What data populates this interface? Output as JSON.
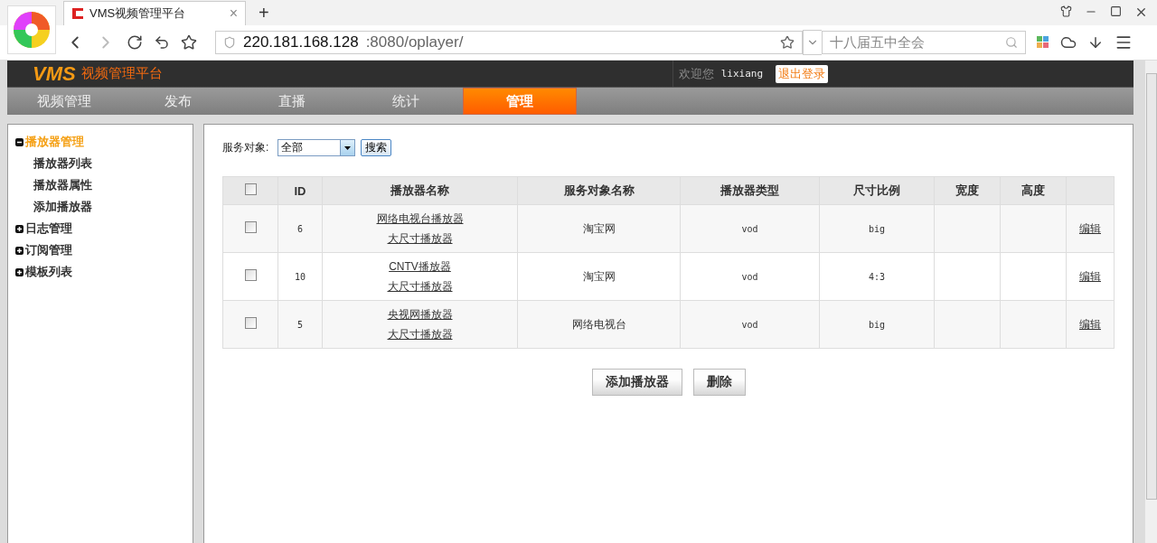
{
  "browser": {
    "tab_title": "VMS视频管理平台",
    "tab_close": "×",
    "new_tab": "+",
    "url_host": "220.181.168.128",
    "url_rest": ":8080/oplayer/",
    "search_placeholder": "十八届五中全会"
  },
  "header": {
    "logo": "VMS",
    "subtitle": "视频管理平台",
    "welcome": "欢迎您",
    "user": "lixiang",
    "logout": "退出登录"
  },
  "nav": [
    {
      "label": "视频管理",
      "selected": false
    },
    {
      "label": "发布",
      "selected": false
    },
    {
      "label": "直播",
      "selected": false
    },
    {
      "label": "统计",
      "selected": false
    },
    {
      "label": "管理",
      "selected": true
    }
  ],
  "sidebar": [
    {
      "label": "播放器管理",
      "expanded": true,
      "selected": true,
      "children": [
        {
          "label": "播放器列表"
        },
        {
          "label": "播放器属性"
        },
        {
          "label": "添加播放器"
        }
      ]
    },
    {
      "label": "日志管理",
      "expanded": false,
      "selected": false
    },
    {
      "label": "订阅管理",
      "expanded": false,
      "selected": false
    },
    {
      "label": "模板列表",
      "expanded": false,
      "selected": false
    }
  ],
  "filter": {
    "label": "服务对象:",
    "value": "全部",
    "button": "搜索"
  },
  "table": {
    "select_all_checked": false,
    "columns": [
      "ID",
      "播放器名称",
      "服务对象名称",
      "播放器类型",
      "尺寸比例",
      "宽度",
      "高度"
    ],
    "rows": [
      {
        "checked": false,
        "id": "6",
        "names": [
          "网络电视台播放器",
          "大尺寸播放器"
        ],
        "service": "淘宝网",
        "type": "vod",
        "ratio": "big",
        "action": "编辑"
      },
      {
        "checked": false,
        "id": "10",
        "names": [
          "CNTV播放器",
          "大尺寸播放器"
        ],
        "service": "淘宝网",
        "type": "vod",
        "ratio": "4:3",
        "action": "编辑"
      },
      {
        "checked": false,
        "id": "5",
        "names": [
          "央视网播放器",
          "大尺寸播放器"
        ],
        "service": "网络电视台",
        "type": "vod",
        "ratio": "big",
        "action": "编辑"
      }
    ]
  },
  "buttons": [
    "添加播放器",
    "删除"
  ]
}
